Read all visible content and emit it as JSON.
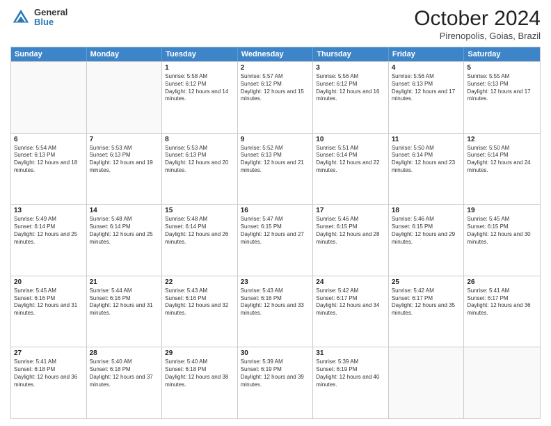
{
  "header": {
    "logo": {
      "general": "General",
      "blue": "Blue"
    },
    "title": "October 2024",
    "location": "Pirenopolis, Goias, Brazil"
  },
  "days_of_week": [
    "Sunday",
    "Monday",
    "Tuesday",
    "Wednesday",
    "Thursday",
    "Friday",
    "Saturday"
  ],
  "rows": [
    [
      {
        "day": "",
        "info": ""
      },
      {
        "day": "",
        "info": ""
      },
      {
        "day": "1",
        "info": "Sunrise: 5:58 AM\nSunset: 6:12 PM\nDaylight: 12 hours and 14 minutes."
      },
      {
        "day": "2",
        "info": "Sunrise: 5:57 AM\nSunset: 6:12 PM\nDaylight: 12 hours and 15 minutes."
      },
      {
        "day": "3",
        "info": "Sunrise: 5:56 AM\nSunset: 6:12 PM\nDaylight: 12 hours and 16 minutes."
      },
      {
        "day": "4",
        "info": "Sunrise: 5:56 AM\nSunset: 6:13 PM\nDaylight: 12 hours and 17 minutes."
      },
      {
        "day": "5",
        "info": "Sunrise: 5:55 AM\nSunset: 6:13 PM\nDaylight: 12 hours and 17 minutes."
      }
    ],
    [
      {
        "day": "6",
        "info": "Sunrise: 5:54 AM\nSunset: 6:13 PM\nDaylight: 12 hours and 18 minutes."
      },
      {
        "day": "7",
        "info": "Sunrise: 5:53 AM\nSunset: 6:13 PM\nDaylight: 12 hours and 19 minutes."
      },
      {
        "day": "8",
        "info": "Sunrise: 5:53 AM\nSunset: 6:13 PM\nDaylight: 12 hours and 20 minutes."
      },
      {
        "day": "9",
        "info": "Sunrise: 5:52 AM\nSunset: 6:13 PM\nDaylight: 12 hours and 21 minutes."
      },
      {
        "day": "10",
        "info": "Sunrise: 5:51 AM\nSunset: 6:14 PM\nDaylight: 12 hours and 22 minutes."
      },
      {
        "day": "11",
        "info": "Sunrise: 5:50 AM\nSunset: 6:14 PM\nDaylight: 12 hours and 23 minutes."
      },
      {
        "day": "12",
        "info": "Sunrise: 5:50 AM\nSunset: 6:14 PM\nDaylight: 12 hours and 24 minutes."
      }
    ],
    [
      {
        "day": "13",
        "info": "Sunrise: 5:49 AM\nSunset: 6:14 PM\nDaylight: 12 hours and 25 minutes."
      },
      {
        "day": "14",
        "info": "Sunrise: 5:48 AM\nSunset: 6:14 PM\nDaylight: 12 hours and 25 minutes."
      },
      {
        "day": "15",
        "info": "Sunrise: 5:48 AM\nSunset: 6:14 PM\nDaylight: 12 hours and 26 minutes."
      },
      {
        "day": "16",
        "info": "Sunrise: 5:47 AM\nSunset: 6:15 PM\nDaylight: 12 hours and 27 minutes."
      },
      {
        "day": "17",
        "info": "Sunrise: 5:46 AM\nSunset: 6:15 PM\nDaylight: 12 hours and 28 minutes."
      },
      {
        "day": "18",
        "info": "Sunrise: 5:46 AM\nSunset: 6:15 PM\nDaylight: 12 hours and 29 minutes."
      },
      {
        "day": "19",
        "info": "Sunrise: 5:45 AM\nSunset: 6:15 PM\nDaylight: 12 hours and 30 minutes."
      }
    ],
    [
      {
        "day": "20",
        "info": "Sunrise: 5:45 AM\nSunset: 6:16 PM\nDaylight: 12 hours and 31 minutes."
      },
      {
        "day": "21",
        "info": "Sunrise: 5:44 AM\nSunset: 6:16 PM\nDaylight: 12 hours and 31 minutes."
      },
      {
        "day": "22",
        "info": "Sunrise: 5:43 AM\nSunset: 6:16 PM\nDaylight: 12 hours and 32 minutes."
      },
      {
        "day": "23",
        "info": "Sunrise: 5:43 AM\nSunset: 6:16 PM\nDaylight: 12 hours and 33 minutes."
      },
      {
        "day": "24",
        "info": "Sunrise: 5:42 AM\nSunset: 6:17 PM\nDaylight: 12 hours and 34 minutes."
      },
      {
        "day": "25",
        "info": "Sunrise: 5:42 AM\nSunset: 6:17 PM\nDaylight: 12 hours and 35 minutes."
      },
      {
        "day": "26",
        "info": "Sunrise: 5:41 AM\nSunset: 6:17 PM\nDaylight: 12 hours and 36 minutes."
      }
    ],
    [
      {
        "day": "27",
        "info": "Sunrise: 5:41 AM\nSunset: 6:18 PM\nDaylight: 12 hours and 36 minutes."
      },
      {
        "day": "28",
        "info": "Sunrise: 5:40 AM\nSunset: 6:18 PM\nDaylight: 12 hours and 37 minutes."
      },
      {
        "day": "29",
        "info": "Sunrise: 5:40 AM\nSunset: 6:18 PM\nDaylight: 12 hours and 38 minutes."
      },
      {
        "day": "30",
        "info": "Sunrise: 5:39 AM\nSunset: 6:19 PM\nDaylight: 12 hours and 39 minutes."
      },
      {
        "day": "31",
        "info": "Sunrise: 5:39 AM\nSunset: 6:19 PM\nDaylight: 12 hours and 40 minutes."
      },
      {
        "day": "",
        "info": ""
      },
      {
        "day": "",
        "info": ""
      }
    ]
  ]
}
